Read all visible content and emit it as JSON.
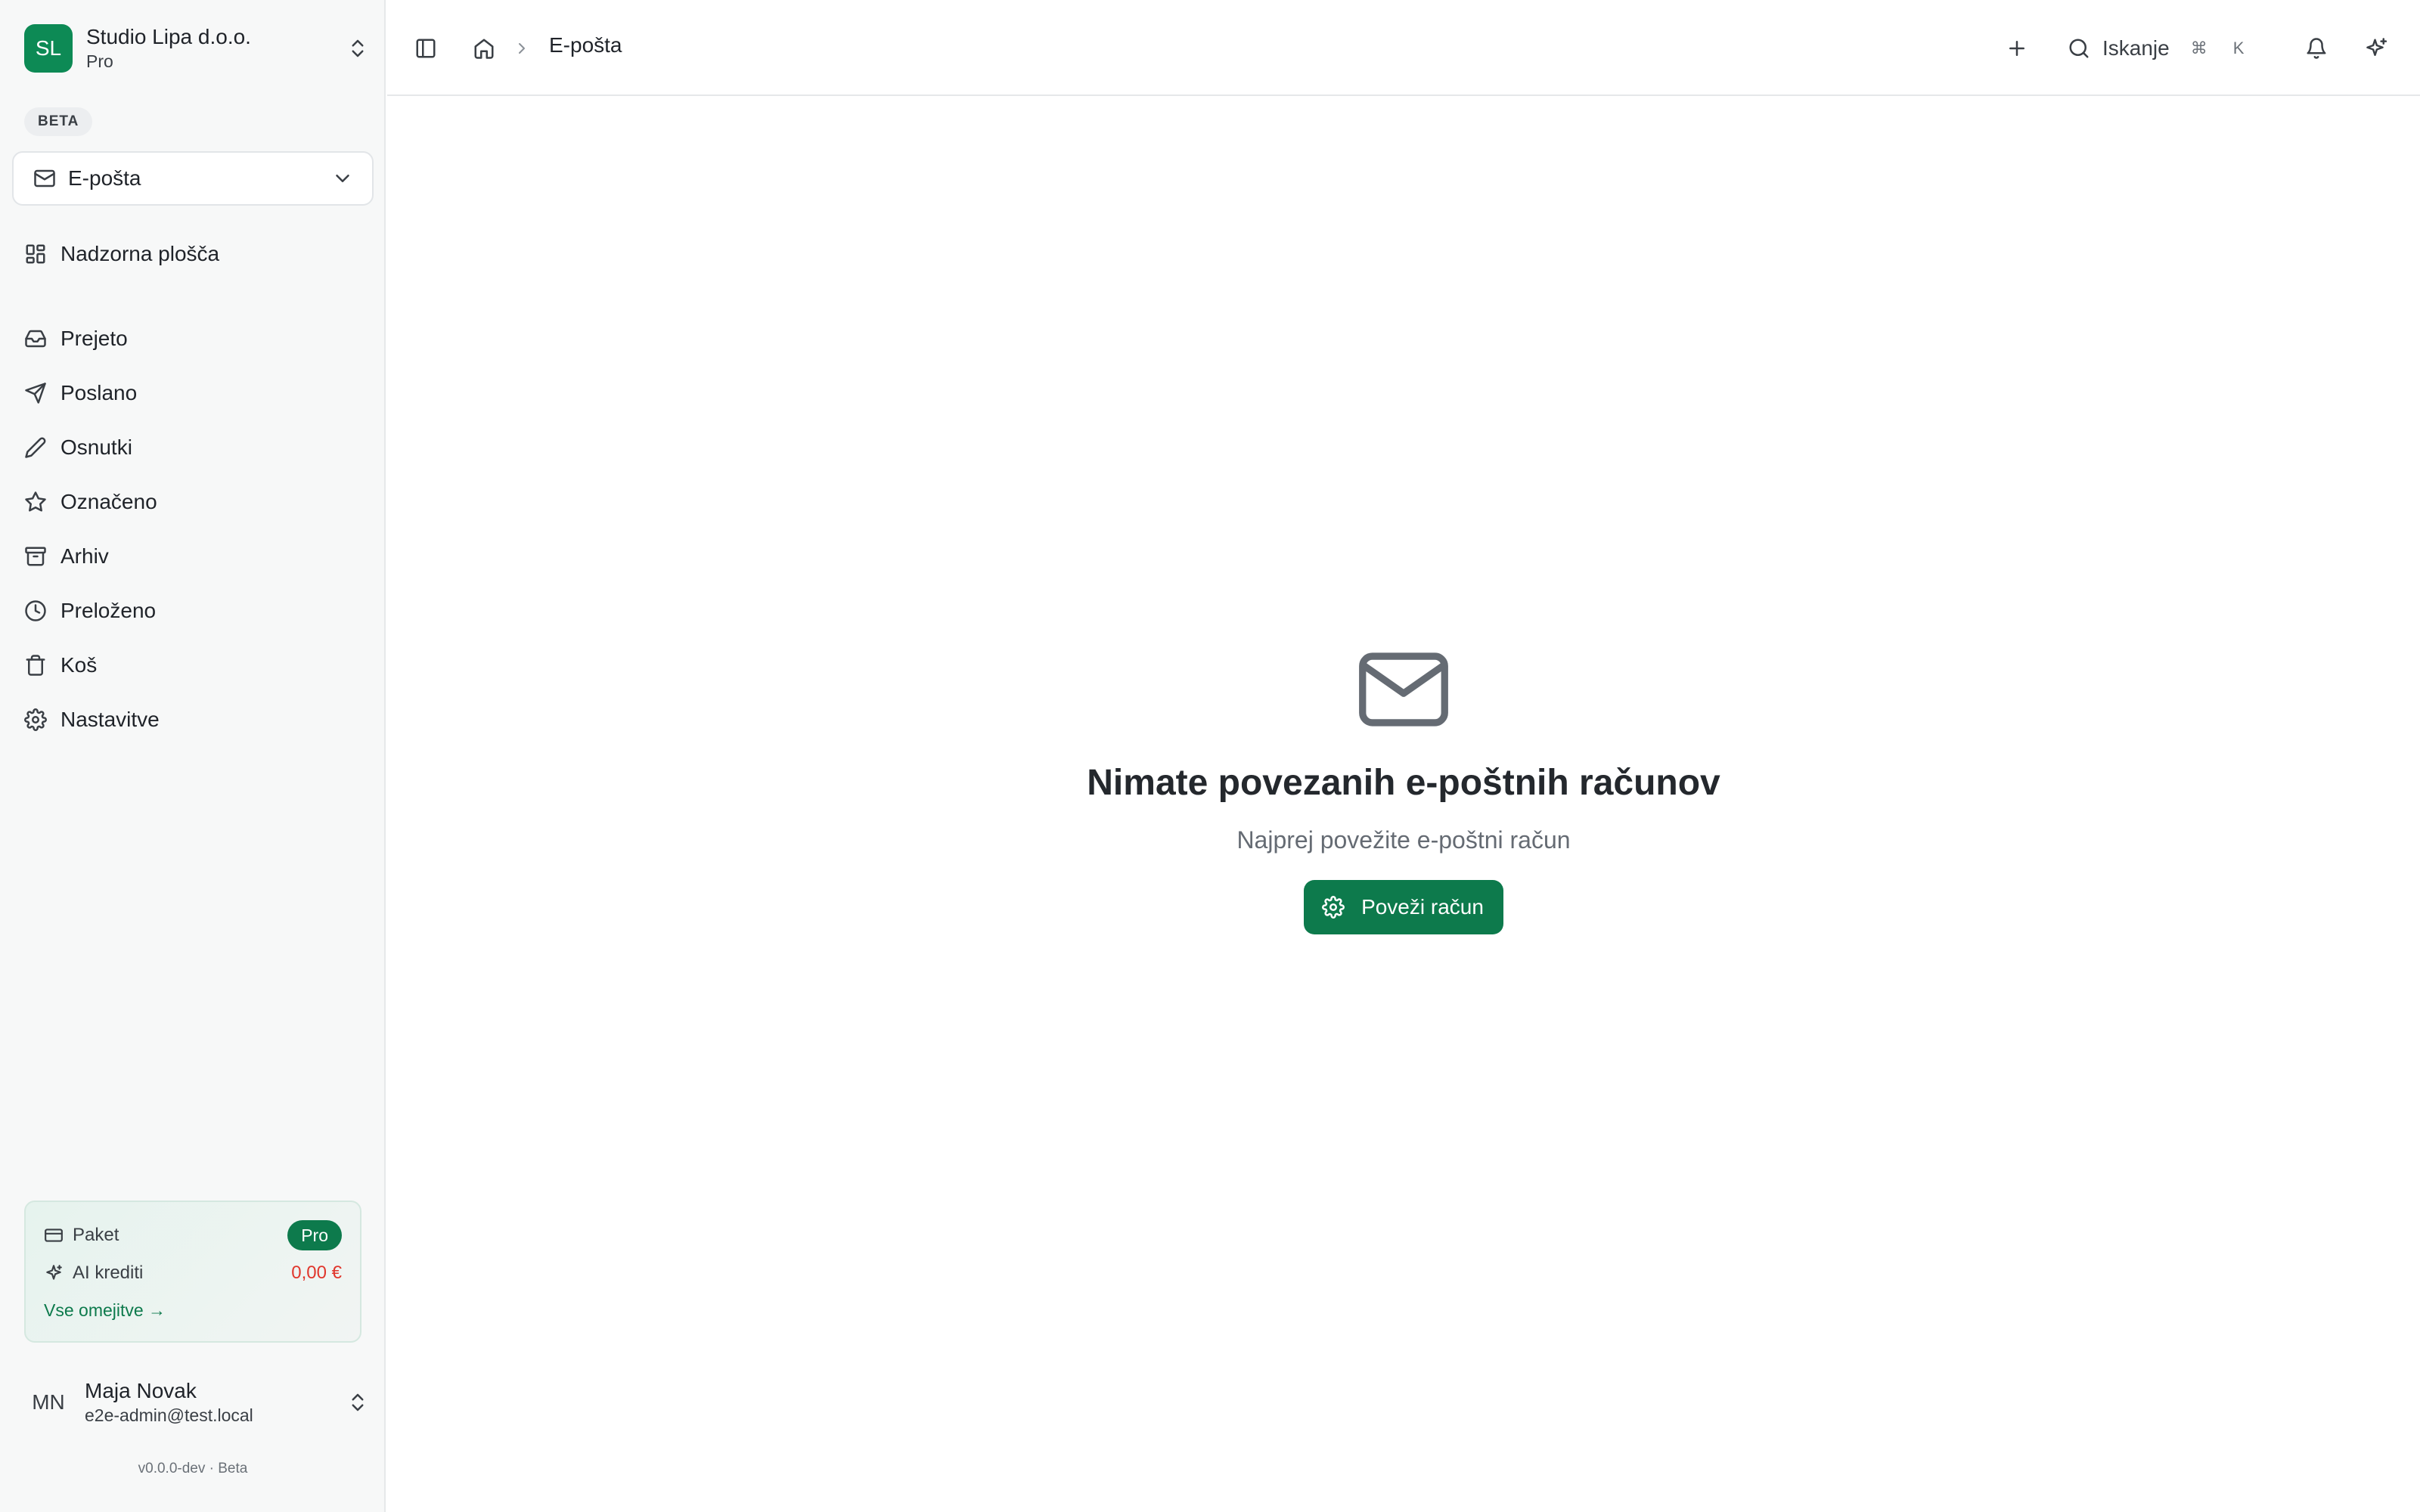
{
  "org": {
    "initials": "SL",
    "name": "Studio Lipa d.o.o.",
    "plan": "Pro"
  },
  "beta_label": "BETA",
  "module_select": {
    "label": "E-pošta"
  },
  "nav": {
    "dashboard": "Nadzorna plošča",
    "items": [
      "Prejeto",
      "Poslano",
      "Osnutki",
      "Označeno",
      "Arhiv",
      "Preloženo",
      "Koš",
      "Nastavitve"
    ]
  },
  "plan_card": {
    "plan_label": "Paket",
    "plan_value": "Pro",
    "credits_label": "AI krediti",
    "credits_value": "0,00 €",
    "limits_link": "Vse omejitve →"
  },
  "user": {
    "initials": "MN",
    "name": "Maja Novak",
    "email": "e2e-admin@test.local"
  },
  "version": "v0.0.0-dev · Beta",
  "header": {
    "breadcrumb_current": "E-pošta",
    "search_label": "Iskanje",
    "shortcut_mod": "⌘",
    "shortcut_key": "K"
  },
  "empty_state": {
    "title": "Nimate povezanih e-poštnih računov",
    "subtitle": "Najprej povežite e-poštni račun",
    "button_label": "Poveži račun"
  },
  "colors": {
    "accent": "#0d7a4c",
    "credits": "#e0362c"
  }
}
